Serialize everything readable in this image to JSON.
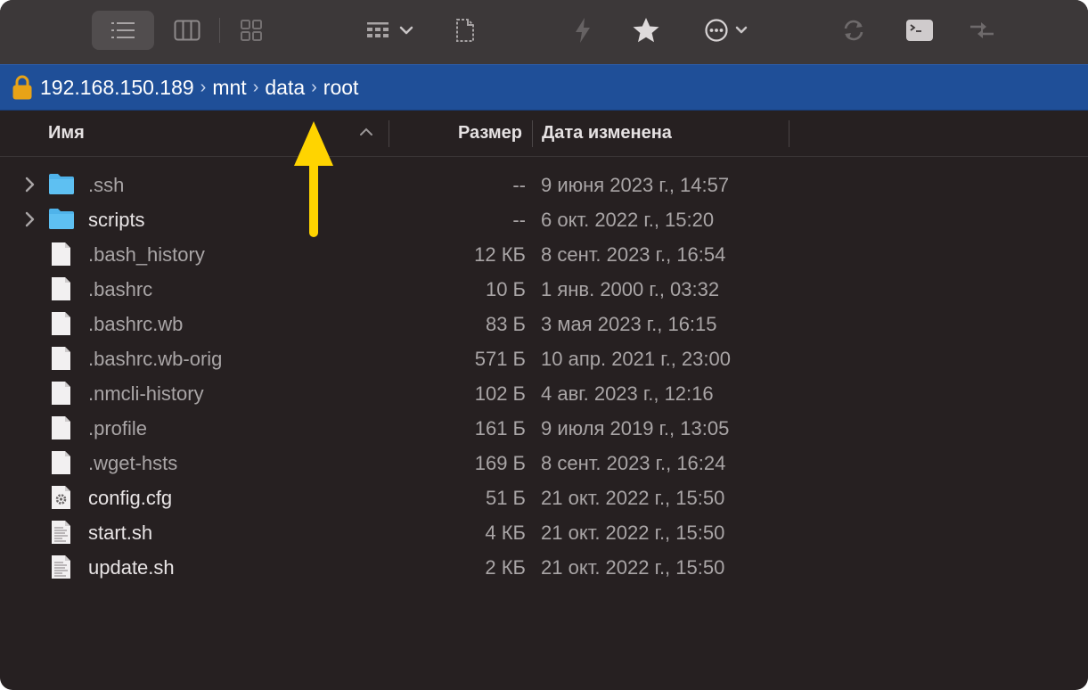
{
  "toolbar": {
    "buttons": [
      "list-view",
      "column-view",
      "gallery-view",
      "group-menu",
      "new-file",
      "lightning",
      "favorite",
      "more-menu",
      "sync",
      "terminal",
      "compare"
    ]
  },
  "pathbar": {
    "crumbs": [
      "192.168.150.189",
      "mnt",
      "data",
      "root"
    ],
    "separator": "›",
    "lock_color": "#e8a317"
  },
  "columns": {
    "name": "Имя",
    "size": "Размер",
    "date": "Дата изменена"
  },
  "files": [
    {
      "name": ".ssh",
      "size": "--",
      "date": "9 июня 2023 г., 14:57",
      "type": "folder",
      "hidden": true
    },
    {
      "name": "scripts",
      "size": "--",
      "date": "6 окт. 2022 г., 15:20",
      "type": "folder",
      "hidden": false
    },
    {
      "name": ".bash_history",
      "size": "12 КБ",
      "date": "8 сент. 2023 г., 16:54",
      "type": "file",
      "hidden": true
    },
    {
      "name": ".bashrc",
      "size": "10 Б",
      "date": "1 янв. 2000 г., 03:32",
      "type": "file",
      "hidden": true
    },
    {
      "name": ".bashrc.wb",
      "size": "83 Б",
      "date": "3 мая 2023 г., 16:15",
      "type": "file",
      "hidden": true
    },
    {
      "name": ".bashrc.wb-orig",
      "size": "571 Б",
      "date": "10 апр. 2021 г., 23:00",
      "type": "file",
      "hidden": true
    },
    {
      "name": ".nmcli-history",
      "size": "102 Б",
      "date": "4 авг. 2023 г., 12:16",
      "type": "file",
      "hidden": true
    },
    {
      "name": ".profile",
      "size": "161 Б",
      "date": "9 июля 2019 г., 13:05",
      "type": "file",
      "hidden": true
    },
    {
      "name": ".wget-hsts",
      "size": "169 Б",
      "date": "8 сент. 2023 г., 16:24",
      "type": "file",
      "hidden": true
    },
    {
      "name": "config.cfg",
      "size": "51 Б",
      "date": "21 окт. 2022 г., 15:50",
      "type": "config",
      "hidden": false
    },
    {
      "name": "start.sh",
      "size": "4 КБ",
      "date": "21 окт. 2022 г., 15:50",
      "type": "script",
      "hidden": false
    },
    {
      "name": "update.sh",
      "size": "2 КБ",
      "date": "21 окт. 2022 г., 15:50",
      "type": "script",
      "hidden": false
    }
  ],
  "colors": {
    "window_bg": "#262021",
    "toolbar_bg": "#3c3839",
    "pathbar_bg": "#1f4f98",
    "folder": "#4fb3ea",
    "annotation_arrow": "#ffd400"
  }
}
